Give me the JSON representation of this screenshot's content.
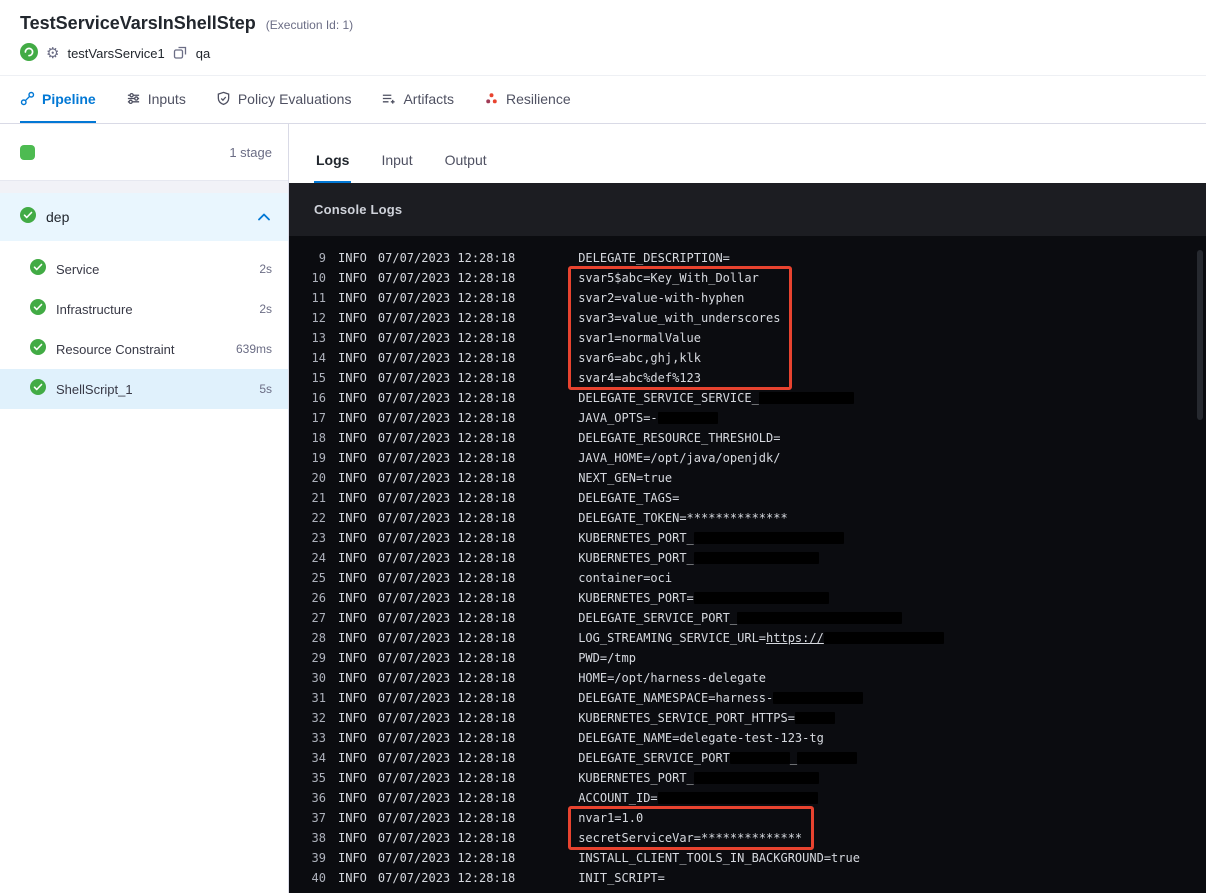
{
  "header": {
    "title": "TestServiceVarsInShellStep",
    "execution_id": "(Execution Id: 1)",
    "service_name": "testVarsService1",
    "environment": "qa",
    "icons": [
      "service-icon",
      "gear-icon",
      "environment-icon"
    ]
  },
  "main_tabs": [
    {
      "label": "Pipeline",
      "icon": "pipeline-icon",
      "active": true
    },
    {
      "label": "Inputs",
      "icon": "inputs-icon",
      "active": false
    },
    {
      "label": "Policy Evaluations",
      "icon": "policy-icon",
      "active": false
    },
    {
      "label": "Artifacts",
      "icon": "artifacts-icon",
      "active": false
    },
    {
      "label": "Resilience",
      "icon": "resilience-icon",
      "active": false
    }
  ],
  "sidebar": {
    "stage_count": "1 stage",
    "stage_name": "dep",
    "stage_status": "success",
    "steps": [
      {
        "label": "Service",
        "duration": "2s",
        "status": "success",
        "selected": false
      },
      {
        "label": "Infrastructure",
        "duration": "2s",
        "status": "success",
        "selected": false
      },
      {
        "label": "Resource Constraint",
        "duration": "639ms",
        "status": "success",
        "selected": false
      },
      {
        "label": "ShellScript_1",
        "duration": "5s",
        "status": "success",
        "selected": true
      }
    ]
  },
  "console": {
    "tabs": [
      {
        "label": "Logs",
        "active": true
      },
      {
        "label": "Input",
        "active": false
      },
      {
        "label": "Output",
        "active": false
      }
    ],
    "header": "Console Logs",
    "level": "INFO",
    "timestamp": "07/07/2023 12:28:18",
    "lines": [
      {
        "n": 9,
        "seg": [
          {
            "t": "DELEGATE_DESCRIPTION="
          }
        ]
      },
      {
        "n": 10,
        "hl": 1,
        "seg": [
          {
            "t": "svar5$abc=Key_With_Dollar"
          }
        ]
      },
      {
        "n": 11,
        "hl": 1,
        "seg": [
          {
            "t": "svar2=value-with-hyphen"
          }
        ]
      },
      {
        "n": 12,
        "hl": 1,
        "seg": [
          {
            "t": "svar3=value_with_underscores"
          }
        ]
      },
      {
        "n": 13,
        "hl": 1,
        "seg": [
          {
            "t": "svar1=normalValue"
          }
        ]
      },
      {
        "n": 14,
        "hl": 1,
        "seg": [
          {
            "t": "svar6=abc,ghj,klk"
          }
        ]
      },
      {
        "n": 15,
        "hl": 1,
        "seg": [
          {
            "t": "svar4=abc%def%123"
          }
        ]
      },
      {
        "n": 16,
        "seg": [
          {
            "t": "DELEGATE_SERVICE_SERVICE_"
          },
          {
            "r": 95
          }
        ]
      },
      {
        "n": 17,
        "seg": [
          {
            "t": "JAVA_OPTS=-"
          },
          {
            "r": 60
          }
        ]
      },
      {
        "n": 18,
        "seg": [
          {
            "t": "DELEGATE_RESOURCE_THRESHOLD="
          }
        ]
      },
      {
        "n": 19,
        "seg": [
          {
            "t": "JAVA_HOME=/opt/java/openjdk/"
          }
        ]
      },
      {
        "n": 20,
        "seg": [
          {
            "t": "NEXT_GEN=true"
          }
        ]
      },
      {
        "n": 21,
        "seg": [
          {
            "t": "DELEGATE_TAGS="
          }
        ]
      },
      {
        "n": 22,
        "seg": [
          {
            "t": "DELEGATE_TOKEN=**************"
          }
        ]
      },
      {
        "n": 23,
        "seg": [
          {
            "t": "KUBERNETES_PORT_"
          },
          {
            "r": 150
          }
        ]
      },
      {
        "n": 24,
        "seg": [
          {
            "t": "KUBERNETES_PORT_"
          },
          {
            "r": 125
          }
        ]
      },
      {
        "n": 25,
        "seg": [
          {
            "t": "container=oci"
          }
        ]
      },
      {
        "n": 26,
        "seg": [
          {
            "t": "KUBERNETES_PORT="
          },
          {
            "r": 135
          }
        ]
      },
      {
        "n": 27,
        "seg": [
          {
            "t": "DELEGATE_SERVICE_PORT_"
          },
          {
            "r": 165
          }
        ]
      },
      {
        "n": 28,
        "seg": [
          {
            "t": "LOG_STREAMING_SERVICE_URL="
          },
          {
            "l": "https://"
          },
          {
            "r": 120
          }
        ]
      },
      {
        "n": 29,
        "seg": [
          {
            "t": "PWD=/tmp"
          }
        ]
      },
      {
        "n": 30,
        "seg": [
          {
            "t": "HOME=/opt/harness-delegate"
          }
        ]
      },
      {
        "n": 31,
        "seg": [
          {
            "t": "DELEGATE_NAMESPACE=harness-"
          },
          {
            "r": 90
          }
        ]
      },
      {
        "n": 32,
        "seg": [
          {
            "t": "KUBERNETES_SERVICE_PORT_HTTPS="
          },
          {
            "r": 40
          }
        ]
      },
      {
        "n": 33,
        "seg": [
          {
            "t": "DELEGATE_NAME=delegate-test-123-tg"
          }
        ]
      },
      {
        "n": 34,
        "seg": [
          {
            "t": "DELEGATE_SERVICE_PORT"
          },
          {
            "r": 60
          },
          {
            "t": "_"
          },
          {
            "r": 60
          }
        ]
      },
      {
        "n": 35,
        "seg": [
          {
            "t": "KUBERNETES_PORT_"
          },
          {
            "r": 125
          }
        ]
      },
      {
        "n": 36,
        "seg": [
          {
            "t": "ACCOUNT_ID="
          },
          {
            "r": 160
          }
        ]
      },
      {
        "n": 37,
        "hl": 2,
        "seg": [
          {
            "t": "nvar1=1.0"
          }
        ]
      },
      {
        "n": 38,
        "hl": 2,
        "seg": [
          {
            "t": "secretServiceVar=**************"
          }
        ]
      },
      {
        "n": 39,
        "seg": [
          {
            "t": "INSTALL_CLIENT_TOOLS_IN_BACKGROUND=true"
          }
        ]
      },
      {
        "n": 40,
        "seg": [
          {
            "t": "INIT_SCRIPT="
          }
        ]
      }
    ]
  },
  "colors": {
    "accent": "#0278d5",
    "success": "#42ab45",
    "highlight_box": "#e8432f",
    "console_bg": "#0b0c10"
  }
}
